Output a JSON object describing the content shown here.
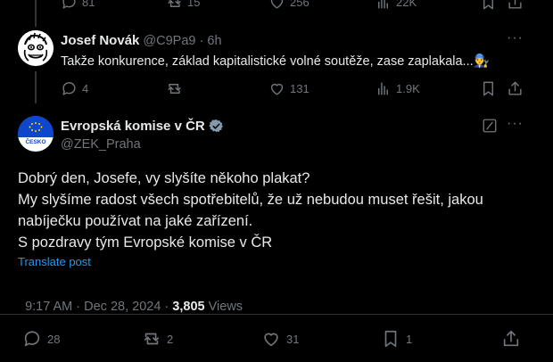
{
  "prev_tweet": {
    "reply_count": "81",
    "retweet_count": "15",
    "like_count": "256",
    "view_count": "22K"
  },
  "reply_tweet": {
    "author_name": "Josef Novák",
    "handle": "@C9Pa9",
    "separator": "·",
    "time": "6h",
    "text": "Takže konkurence, základ kapitalistické volné soutěže, zase zaplakala...",
    "emoji": "👨‍🔧",
    "reply_count": "4",
    "retweet_count": "",
    "like_count": "131",
    "view_count": "1.9K"
  },
  "main_tweet": {
    "author_name": "Evropská komise v ČR",
    "handle": "@ZEK_Praha",
    "avatar_label": "ČESKO",
    "text_lines": [
      "Dobrý den, Josefe, vy slyšíte někoho plakat?",
      "My slyšíme radost všech spotřebitelů, že už nebudou muset řešit, jakou",
      "nabíječku používat na jaké zařízení.",
      "S pozdravy tým Evropské komise v ČR"
    ],
    "translate_label": "Translate post",
    "timestamp": "9:17 AM · Dec 28, 2024 · ",
    "views_count": "3,805",
    "views_label": " Views",
    "reply_count": "28",
    "retweet_count": "2",
    "like_count": "31",
    "bookmark_count": "1"
  },
  "colors": {
    "background": "#000000",
    "text": "#e7e9ea",
    "muted": "#71767b",
    "link": "#1d9bf0",
    "divider": "#2f3336",
    "eu_blue": "#0e47cb",
    "verified_badge": "#829aab"
  }
}
